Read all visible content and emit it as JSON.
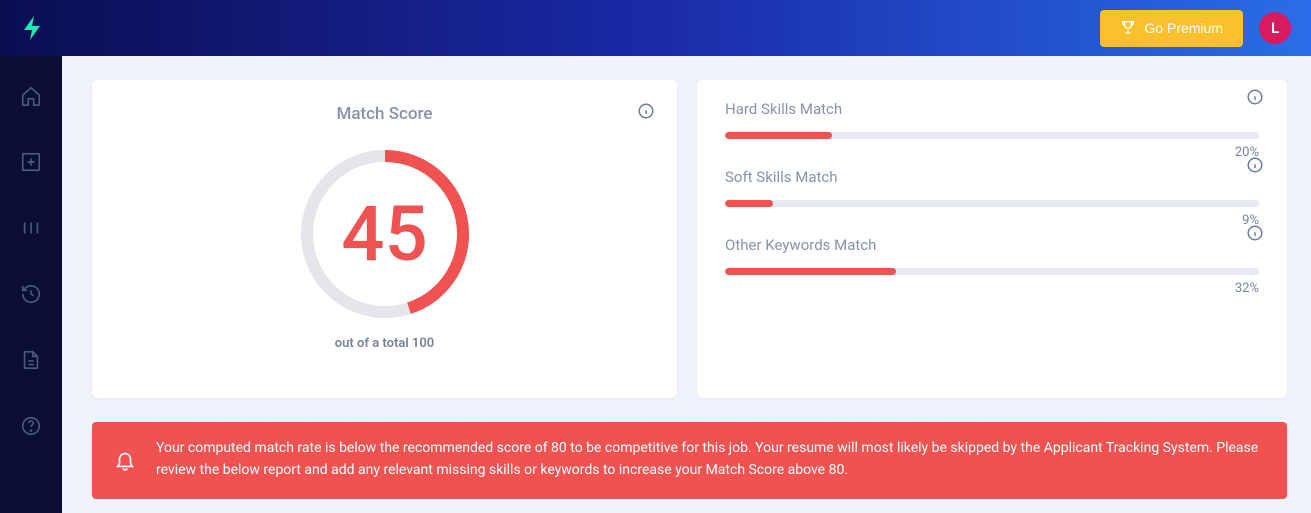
{
  "header": {
    "premium_label": "Go Premium",
    "avatar_initial": "L"
  },
  "score_card": {
    "title": "Match Score",
    "value": 45,
    "max": 100,
    "subtitle": "out of a total 100",
    "ring_color": "#f05252",
    "ring_bg": "#e4e6ec"
  },
  "metrics": [
    {
      "label": "Hard Skills Match",
      "pct": 20,
      "display": "20%"
    },
    {
      "label": "Soft Skills Match",
      "pct": 9,
      "display": "9%"
    },
    {
      "label": "Other Keywords Match",
      "pct": 32,
      "display": "32%"
    }
  ],
  "banner": {
    "text": "Your computed match rate is below the recommended score of 80 to be competitive for this job. Your resume will most likely be skipped by the Applicant Tracking System. Please review the below report and add any relevant missing skills or keywords to increase your Match Score above 80."
  }
}
